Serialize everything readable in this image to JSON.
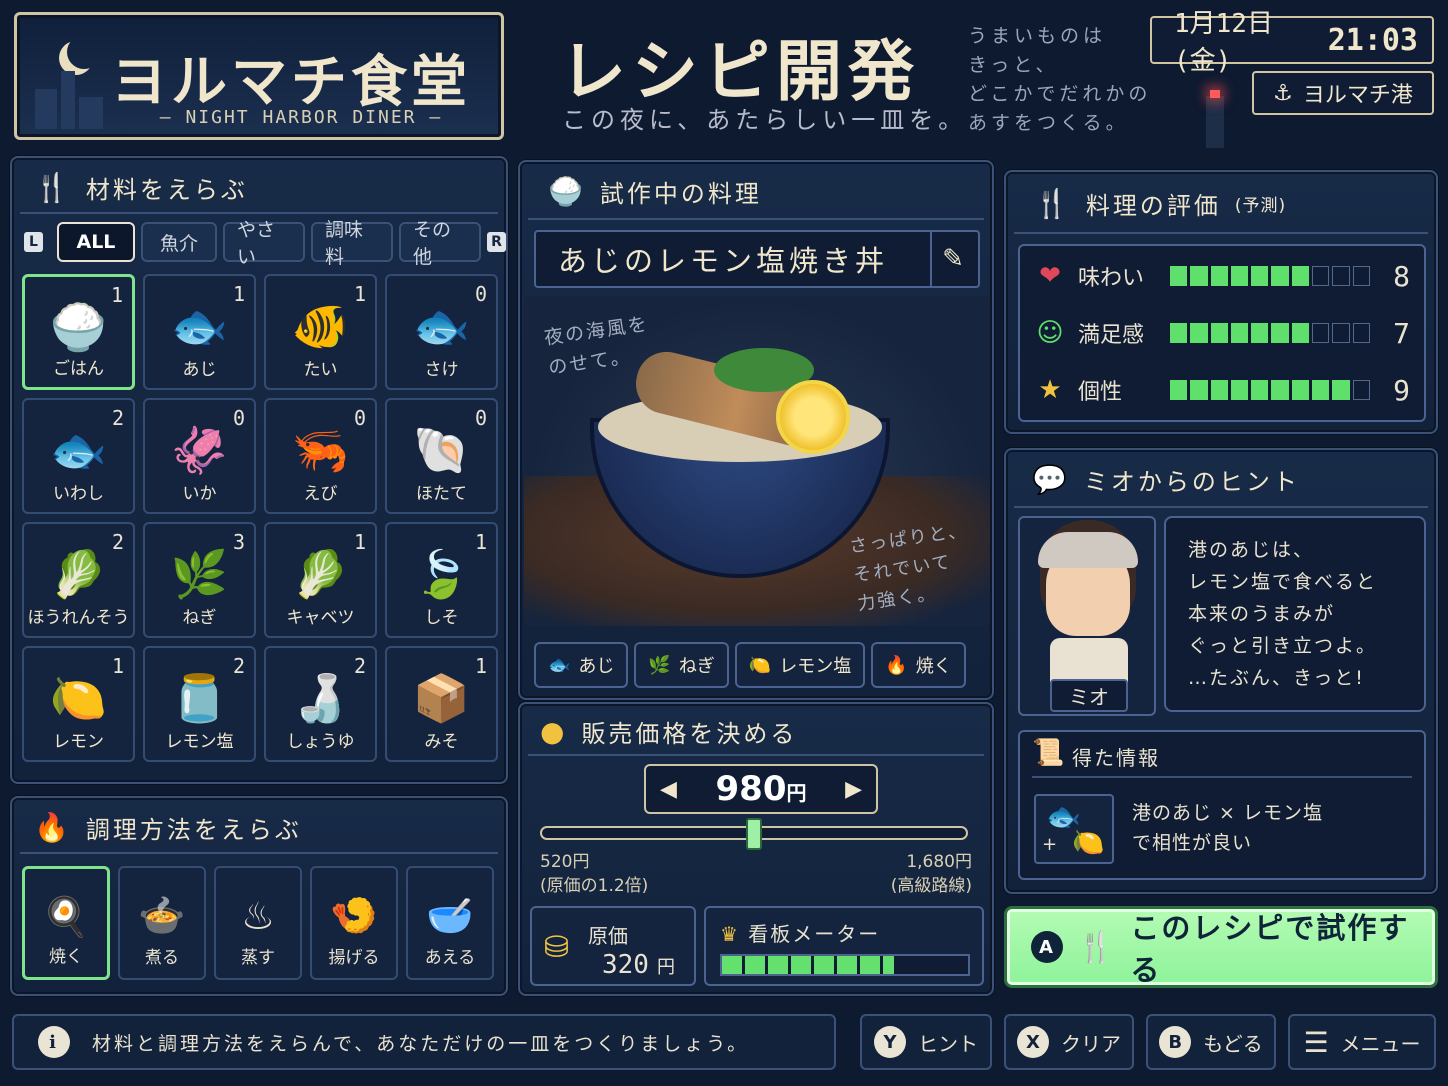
{
  "header": {
    "logo_title": "ヨルマチ食堂",
    "logo_subtitle": "— NIGHT HARBOR DINER —",
    "screen_title": "レシピ開発",
    "tagline": "この夜に、あたらしい一皿を。",
    "poem": [
      "うまいものは",
      "きっと、",
      "どこかでだれかの",
      "あすをつくる。"
    ],
    "date": "1月12日(金)",
    "time": "21:03",
    "location": "ヨルマチ港"
  },
  "ingredients": {
    "title": "材料をえらぶ",
    "shoulder_left": "L",
    "shoulder_right": "R",
    "tabs": [
      "ALL",
      "魚介",
      "やさい",
      "調味料",
      "その他"
    ],
    "items": [
      {
        "name": "ごはん",
        "count": "1",
        "icon": "rice-bowl-icon",
        "glyph": "🍚"
      },
      {
        "name": "あじ",
        "count": "1",
        "icon": "horse-mackerel-icon",
        "glyph": "🐟"
      },
      {
        "name": "たい",
        "count": "1",
        "icon": "sea-bream-icon",
        "glyph": "🐠"
      },
      {
        "name": "さけ",
        "count": "0",
        "icon": "salmon-icon",
        "glyph": "🐟"
      },
      {
        "name": "いわし",
        "count": "2",
        "icon": "sardine-icon",
        "glyph": "🐟"
      },
      {
        "name": "いか",
        "count": "0",
        "icon": "squid-icon",
        "glyph": "🦑"
      },
      {
        "name": "えび",
        "count": "0",
        "icon": "shrimp-icon",
        "glyph": "🦐"
      },
      {
        "name": "ほたて",
        "count": "0",
        "icon": "scallop-icon",
        "glyph": "🐚"
      },
      {
        "name": "ほうれんそう",
        "count": "2",
        "icon": "spinach-icon",
        "glyph": "🥬"
      },
      {
        "name": "ねぎ",
        "count": "3",
        "icon": "green-onion-icon",
        "glyph": "🌿"
      },
      {
        "name": "キャベツ",
        "count": "1",
        "icon": "cabbage-icon",
        "glyph": "🥬"
      },
      {
        "name": "しそ",
        "count": "1",
        "icon": "shiso-leaf-icon",
        "glyph": "🍃"
      },
      {
        "name": "レモン",
        "count": "1",
        "icon": "lemon-icon",
        "glyph": "🍋"
      },
      {
        "name": "レモン塩",
        "count": "2",
        "icon": "lemon-salt-jar-icon",
        "glyph": "🫙"
      },
      {
        "name": "しょうゆ",
        "count": "2",
        "icon": "soy-sauce-icon",
        "glyph": "🍶"
      },
      {
        "name": "みそ",
        "count": "1",
        "icon": "miso-icon",
        "glyph": "📦"
      }
    ]
  },
  "cooking": {
    "title": "調理方法をえらぶ",
    "methods": [
      {
        "name": "焼く",
        "icon": "frying-pan-icon",
        "glyph": "🍳"
      },
      {
        "name": "煮る",
        "icon": "pot-icon",
        "glyph": "🍲"
      },
      {
        "name": "蒸す",
        "icon": "steamer-icon",
        "glyph": "♨"
      },
      {
        "name": "揚げる",
        "icon": "deep-fry-icon",
        "glyph": "🍤"
      },
      {
        "name": "あえる",
        "icon": "mixing-bowl-icon",
        "glyph": "🥣"
      }
    ]
  },
  "dish": {
    "title": "試作中の料理",
    "name": "あじのレモン塩焼き丼",
    "note_left": [
      "夜の海風を",
      "のせて。"
    ],
    "note_right": [
      "さっぱりと、",
      "それでいて",
      "力強く。"
    ],
    "chips": [
      {
        "label": "あじ",
        "icon": "fish-icon",
        "glyph": "🐟"
      },
      {
        "label": "ねぎ",
        "icon": "green-onion-icon",
        "glyph": "🌿"
      },
      {
        "label": "レモン塩",
        "icon": "lemon-icon",
        "glyph": "🍋"
      },
      {
        "label": "焼く",
        "icon": "flame-icon",
        "glyph": "🔥"
      }
    ]
  },
  "price": {
    "title": "販売価格を決める",
    "value": "980",
    "unit": "円",
    "slider_fraction": 0.5,
    "min_value": "520円",
    "min_note": "(原価の1.2倍)",
    "max_value": "1,680円",
    "max_note": "(高級路線)",
    "cost_label": "原価",
    "cost_value": "320",
    "cost_unit": "円",
    "meter_label": "看板メーター",
    "meter_fraction": 0.7
  },
  "evaluation": {
    "title": "料理の評価",
    "subtitle": "(予測)",
    "rows": [
      {
        "label": "味わい",
        "score": "8",
        "filled": 7,
        "total": 10,
        "icon": "heart-icon",
        "glyph": "❤",
        "color": "#e0485a"
      },
      {
        "label": "満足感",
        "score": "7",
        "filled": 7,
        "total": 10,
        "icon": "smile-icon",
        "glyph": "☺",
        "color": "#5fe06c"
      },
      {
        "label": "個性",
        "score": "9",
        "filled": 9,
        "total": 10,
        "icon": "star-icon",
        "glyph": "★",
        "color": "#f0c240"
      }
    ]
  },
  "hint": {
    "title": "ミオからのヒント",
    "character_name": "ミオ",
    "lines": [
      "港のあじは、",
      "レモン塩で食べると",
      "本来のうまみが",
      "ぐっと引き立つよ。",
      "…たぶん、きっと!"
    ],
    "info_title": "得た情報",
    "info_lines": [
      "港のあじ × レモン塩",
      "で相性が良い"
    ]
  },
  "action": {
    "badge": "A",
    "label": "このレシピで試作する"
  },
  "footer": {
    "message": "材料と調理方法をえらんで、あなただけの一皿をつくりましょう。",
    "buttons": [
      {
        "badge": "Y",
        "label": "ヒント"
      },
      {
        "badge": "X",
        "label": "クリア"
      },
      {
        "badge": "B",
        "label": "もどる"
      },
      {
        "badge": "☰",
        "label": "メニュー"
      }
    ]
  },
  "colors": {
    "background": "#0d1a30",
    "panel": "#172a47",
    "accent_green": "#7ee58c",
    "bar_green": "#5fe06c",
    "text": "#efe6cc"
  }
}
